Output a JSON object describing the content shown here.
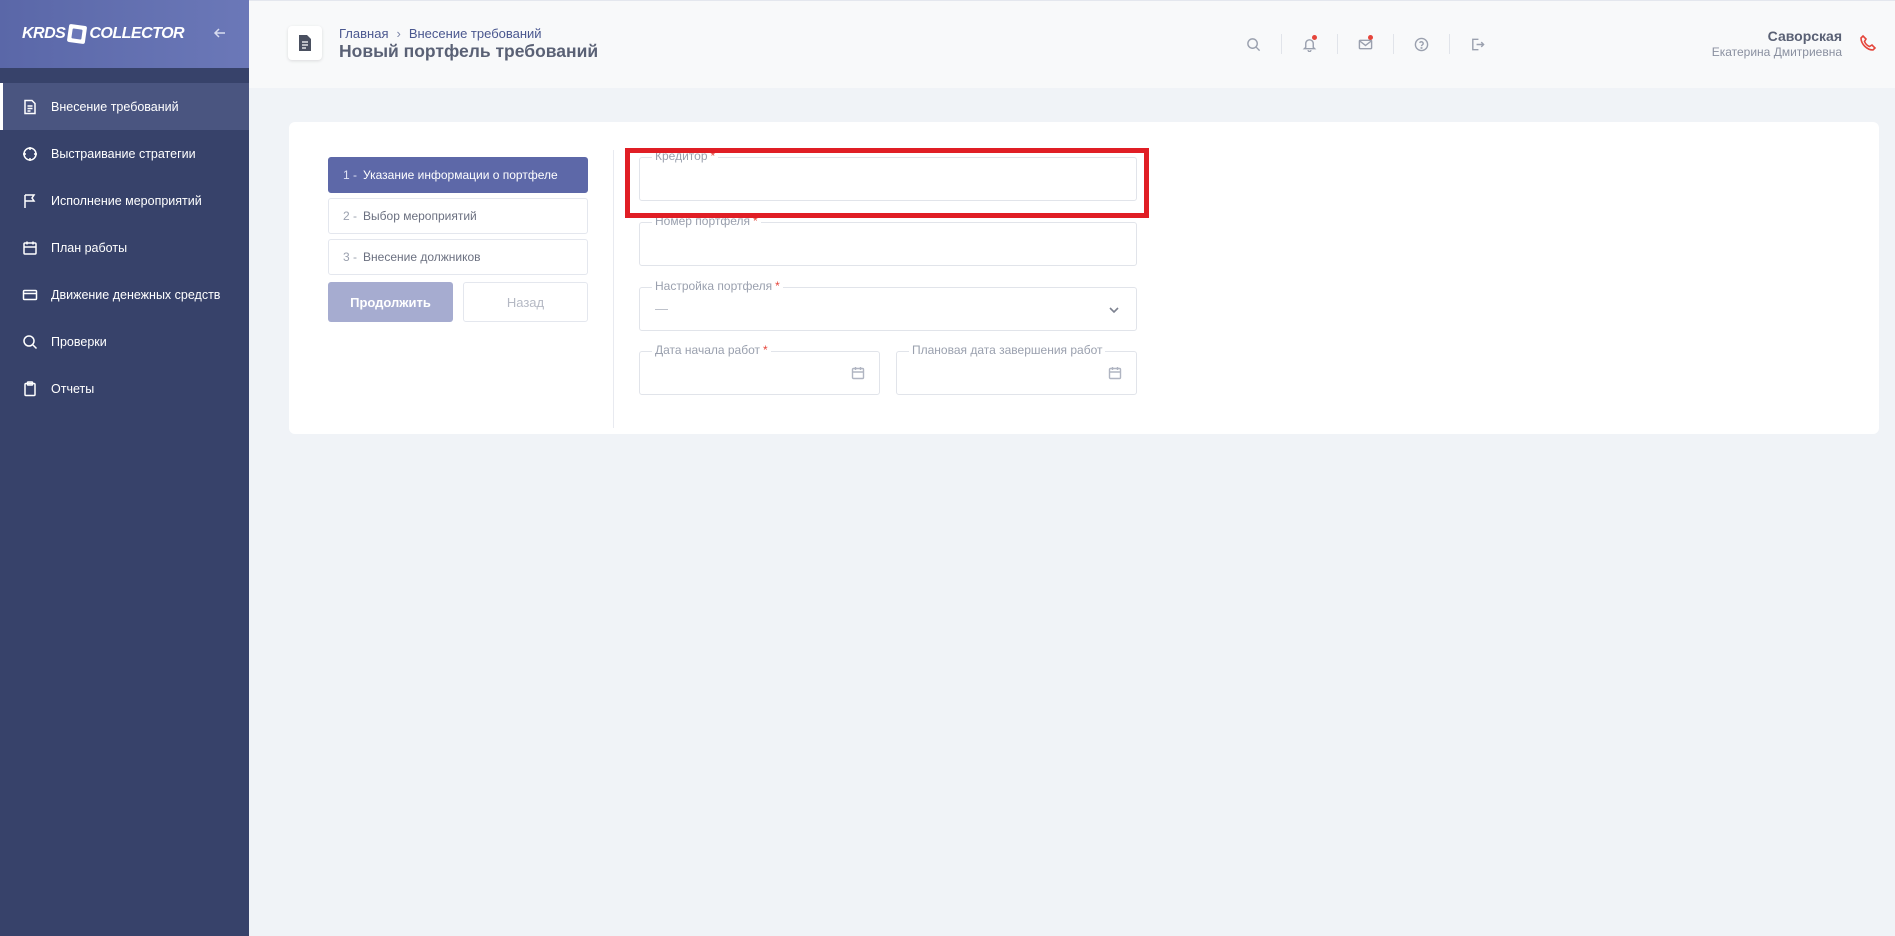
{
  "sidebar": {
    "logo_left": "KRDS",
    "logo_right": "COLLECTOR",
    "items": [
      {
        "label": "Внесение требований",
        "icon": "document-icon",
        "active": true
      },
      {
        "label": "Выстраивание стратегии",
        "icon": "crosshair-icon",
        "active": false
      },
      {
        "label": "Исполнение мероприятий",
        "icon": "flag-icon",
        "active": false
      },
      {
        "label": "План работы",
        "icon": "calendar-icon",
        "active": false
      },
      {
        "label": "Движение денежных средств",
        "icon": "credit-card-icon",
        "active": false
      },
      {
        "label": "Проверки",
        "icon": "search-icon",
        "active": false
      },
      {
        "label": "Отчеты",
        "icon": "clipboard-icon",
        "active": false
      }
    ]
  },
  "header": {
    "breadcrumb": [
      "Главная",
      "Внесение требований"
    ],
    "title": "Новый портфель требований",
    "icons": [
      "search-icon",
      "bell-icon",
      "mail-icon",
      "help-icon",
      "logout-icon"
    ],
    "user": {
      "last_name": "Саворская",
      "first_name": "Екатерина Дмитриевна"
    }
  },
  "steps": {
    "items": [
      {
        "num": "1 -",
        "label": "Указание информации о портфеле",
        "active": true
      },
      {
        "num": "2 -",
        "label": "Выбор мероприятий",
        "active": false
      },
      {
        "num": "3 -",
        "label": "Внесение должников",
        "active": false
      }
    ],
    "continue_label": "Продолжить",
    "back_label": "Назад"
  },
  "form": {
    "creditor": {
      "label": "Кредитор",
      "value": ""
    },
    "portfolio_number": {
      "label": "Номер портфеля",
      "value": ""
    },
    "portfolio_setting": {
      "label": "Настройка портфеля",
      "value": "—"
    },
    "start_date": {
      "label": "Дата начала работ",
      "value": ""
    },
    "planned_end_date": {
      "label": "Плановая дата завершения работ",
      "value": ""
    },
    "required_mark": "*"
  },
  "colors": {
    "sidebar": "#37426a",
    "accent": "#5d68a8",
    "highlight": "#e01e25",
    "required": "#e5453b"
  }
}
